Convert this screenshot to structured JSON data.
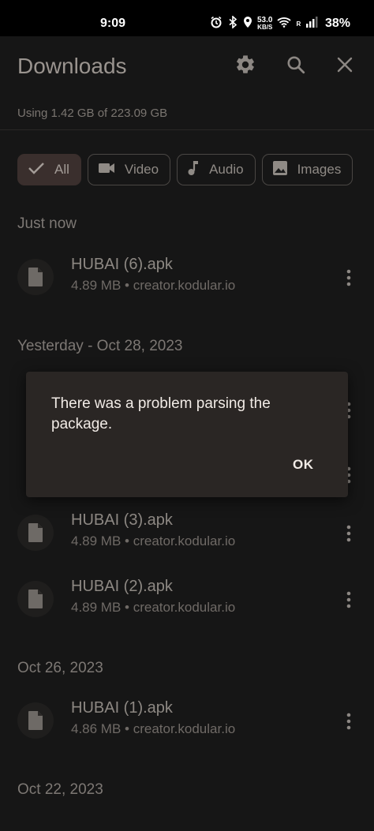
{
  "status_bar": {
    "time": "9:09",
    "net_speed_value": "53.0",
    "net_speed_unit": "KB/S",
    "roaming": "R",
    "battery": "38%",
    "icons": [
      "alarm-icon",
      "bluetooth-icon",
      "location-icon",
      "wifi-icon",
      "signal-icon"
    ]
  },
  "header": {
    "title": "Downloads",
    "storage_text": "Using 1.42 GB of 223.09 GB",
    "actions": [
      "gear-icon",
      "search-icon",
      "close-icon"
    ]
  },
  "filters": [
    {
      "label": "All",
      "icon": "check-icon",
      "selected": true
    },
    {
      "label": "Video",
      "icon": "video-icon",
      "selected": false
    },
    {
      "label": "Audio",
      "icon": "music-note-icon",
      "selected": false
    },
    {
      "label": "Images",
      "icon": "image-icon",
      "selected": false
    }
  ],
  "sections": [
    {
      "title": "Just now",
      "items": [
        {
          "name": "HUBAI (6).apk",
          "meta": "4.89 MB • creator.kodular.io"
        }
      ]
    },
    {
      "title": "Yesterday - Oct 28, 2023",
      "items": [
        {
          "name": "HUBAI (3).apk",
          "meta": "4.89 MB • creator.kodular.io"
        },
        {
          "name": "HUBAI (2).apk",
          "meta": "4.89 MB • creator.kodular.io"
        }
      ]
    },
    {
      "title": "Oct 26, 2023",
      "items": [
        {
          "name": "HUBAI (1).apk",
          "meta": "4.86 MB • creator.kodular.io"
        }
      ]
    },
    {
      "title": "Oct 22, 2023",
      "items": []
    }
  ],
  "dialog": {
    "message": "There was a problem parsing the package.",
    "ok_label": "OK"
  },
  "colors": {
    "background": "#161616",
    "dialog_bg": "#2a2624",
    "active_chip_bg": "#3a2f2d",
    "text_primary": "#f1ebe6"
  }
}
